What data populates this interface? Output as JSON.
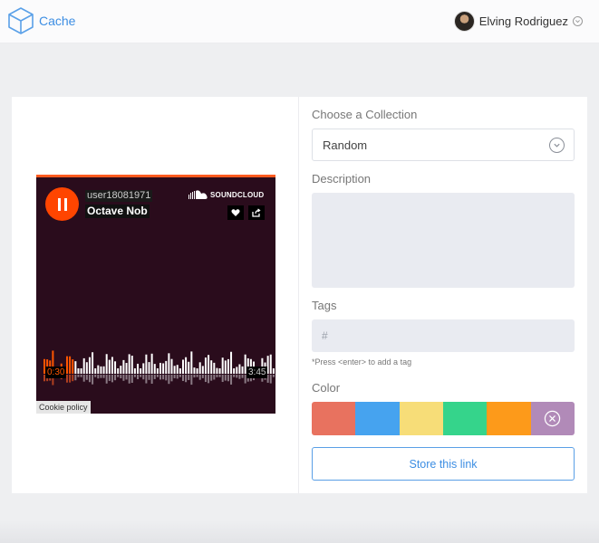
{
  "header": {
    "brand": "Cache",
    "user_name": "Elving Rodriguez",
    "accent_color": "#3d8ee3"
  },
  "player": {
    "username": "user18081971",
    "track_title": "Octave Nob",
    "brand": "SOUNDCLOUD",
    "time_current": "0:30",
    "time_total": "3:45",
    "progress": 0.133,
    "cookie_policy": "Cookie policy"
  },
  "form": {
    "collection_label": "Choose a Collection",
    "collection_value": "Random",
    "description_label": "Description",
    "description_value": "",
    "tags_label": "Tags",
    "tags_placeholder": "#",
    "tags_hint": "*Press <enter> to add a tag",
    "color_label": "Color",
    "colors": [
      {
        "name": "red",
        "hex": "#e8725f"
      },
      {
        "name": "blue",
        "hex": "#46a3ef"
      },
      {
        "name": "yellow",
        "hex": "#f7dd78"
      },
      {
        "name": "green",
        "hex": "#35d48b"
      },
      {
        "name": "orange",
        "hex": "#fd9a1a"
      },
      {
        "name": "clear",
        "hex": "#b18ab8",
        "icon": "close-circle-icon"
      }
    ],
    "submit_label": "Store this link"
  }
}
